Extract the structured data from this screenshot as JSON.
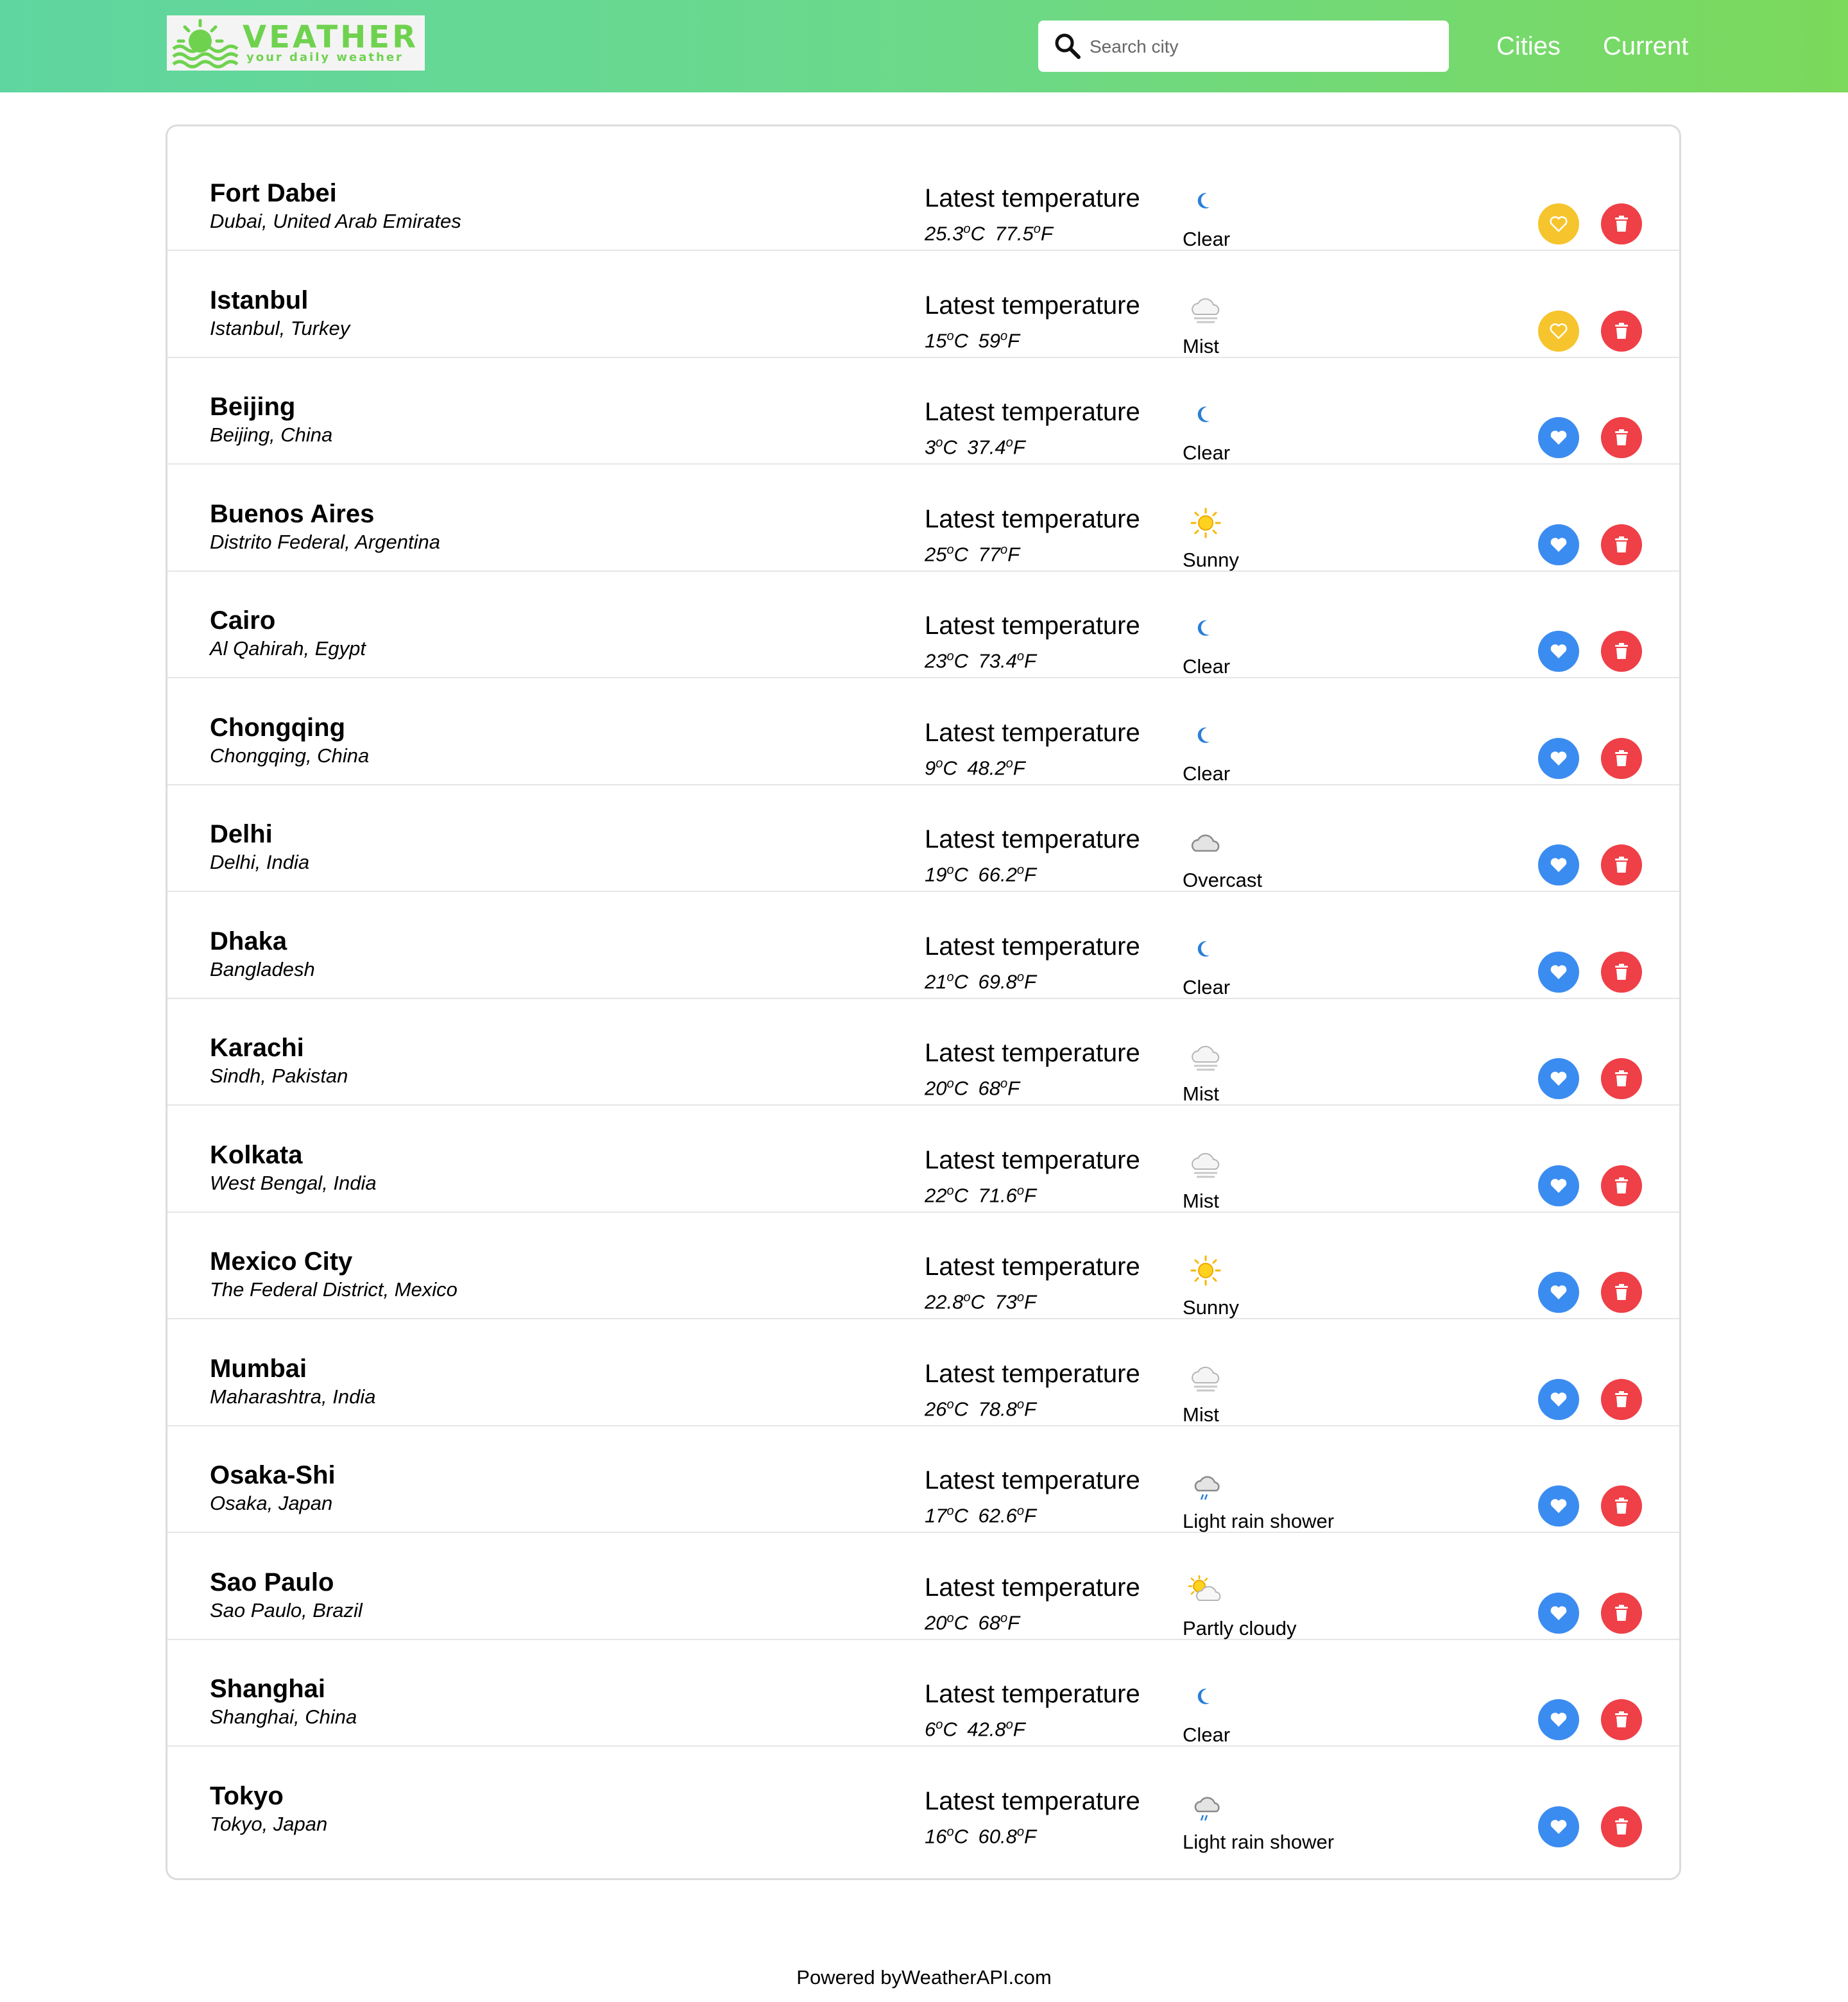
{
  "header": {
    "logo_title": "VEATHER",
    "logo_subtitle": "your daily weather",
    "search_placeholder": "Search city",
    "nav": [
      "Cities",
      "Current"
    ]
  },
  "latest_label": "Latest temperature",
  "cities": [
    {
      "name": "Fort Dabei",
      "region": "Dubai, United Arab Emirates",
      "temp_c": "25.3",
      "temp_f": "77.5",
      "condition": "Clear",
      "icon": "moon-icon",
      "favorite": true
    },
    {
      "name": "Istanbul",
      "region": "Istanbul, Turkey",
      "temp_c": "15",
      "temp_f": "59",
      "condition": "Mist",
      "icon": "mist-icon",
      "favorite": true
    },
    {
      "name": "Beijing",
      "region": "Beijing, China",
      "temp_c": "3",
      "temp_f": "37.4",
      "condition": "Clear",
      "icon": "moon-icon",
      "favorite": false
    },
    {
      "name": "Buenos Aires",
      "region": "Distrito Federal, Argentina",
      "temp_c": "25",
      "temp_f": "77",
      "condition": "Sunny",
      "icon": "sun-icon",
      "favorite": false
    },
    {
      "name": "Cairo",
      "region": "Al Qahirah, Egypt",
      "temp_c": "23",
      "temp_f": "73.4",
      "condition": "Clear",
      "icon": "moon-icon",
      "favorite": false
    },
    {
      "name": "Chongqing",
      "region": "Chongqing, China",
      "temp_c": "9",
      "temp_f": "48.2",
      "condition": "Clear",
      "icon": "moon-icon",
      "favorite": false
    },
    {
      "name": "Delhi",
      "region": "Delhi, India",
      "temp_c": "19",
      "temp_f": "66.2",
      "condition": "Overcast",
      "icon": "cloud-icon",
      "favorite": false
    },
    {
      "name": "Dhaka",
      "region": "Bangladesh",
      "temp_c": "21",
      "temp_f": "69.8",
      "condition": "Clear",
      "icon": "moon-icon",
      "favorite": false
    },
    {
      "name": "Karachi",
      "region": "Sindh, Pakistan",
      "temp_c": "20",
      "temp_f": "68",
      "condition": "Mist",
      "icon": "mist-icon",
      "favorite": false
    },
    {
      "name": "Kolkata",
      "region": "West Bengal, India",
      "temp_c": "22",
      "temp_f": "71.6",
      "condition": "Mist",
      "icon": "mist-icon",
      "favorite": false
    },
    {
      "name": "Mexico City",
      "region": "The Federal District, Mexico",
      "temp_c": "22.8",
      "temp_f": "73",
      "condition": "Sunny",
      "icon": "sun-icon",
      "favorite": false
    },
    {
      "name": "Mumbai",
      "region": "Maharashtra, India",
      "temp_c": "26",
      "temp_f": "78.8",
      "condition": "Mist",
      "icon": "mist-icon",
      "favorite": false
    },
    {
      "name": "Osaka-Shi",
      "region": "Osaka, Japan",
      "temp_c": "17",
      "temp_f": "62.6",
      "condition": "Light rain shower",
      "icon": "night-rain-icon",
      "favorite": false
    },
    {
      "name": "Sao Paulo",
      "region": "Sao Paulo, Brazil",
      "temp_c": "20",
      "temp_f": "68",
      "condition": "Partly cloudy",
      "icon": "partly-cloudy-icon",
      "favorite": false
    },
    {
      "name": "Shanghai",
      "region": "Shanghai, China",
      "temp_c": "6",
      "temp_f": "42.8",
      "condition": "Clear",
      "icon": "moon-icon",
      "favorite": false
    },
    {
      "name": "Tokyo",
      "region": "Tokyo, Japan",
      "temp_c": "16",
      "temp_f": "60.8",
      "condition": "Light rain shower",
      "icon": "night-rain-icon",
      "favorite": false
    }
  ],
  "footer": {
    "text": "Powered byWeatherAPI.com"
  },
  "colors": {
    "favorite": "#f6c42c",
    "like": "#3b8cf0",
    "delete": "#ef3f47",
    "header_start": "#5fd6a0",
    "header_end": "#7bd95b"
  }
}
